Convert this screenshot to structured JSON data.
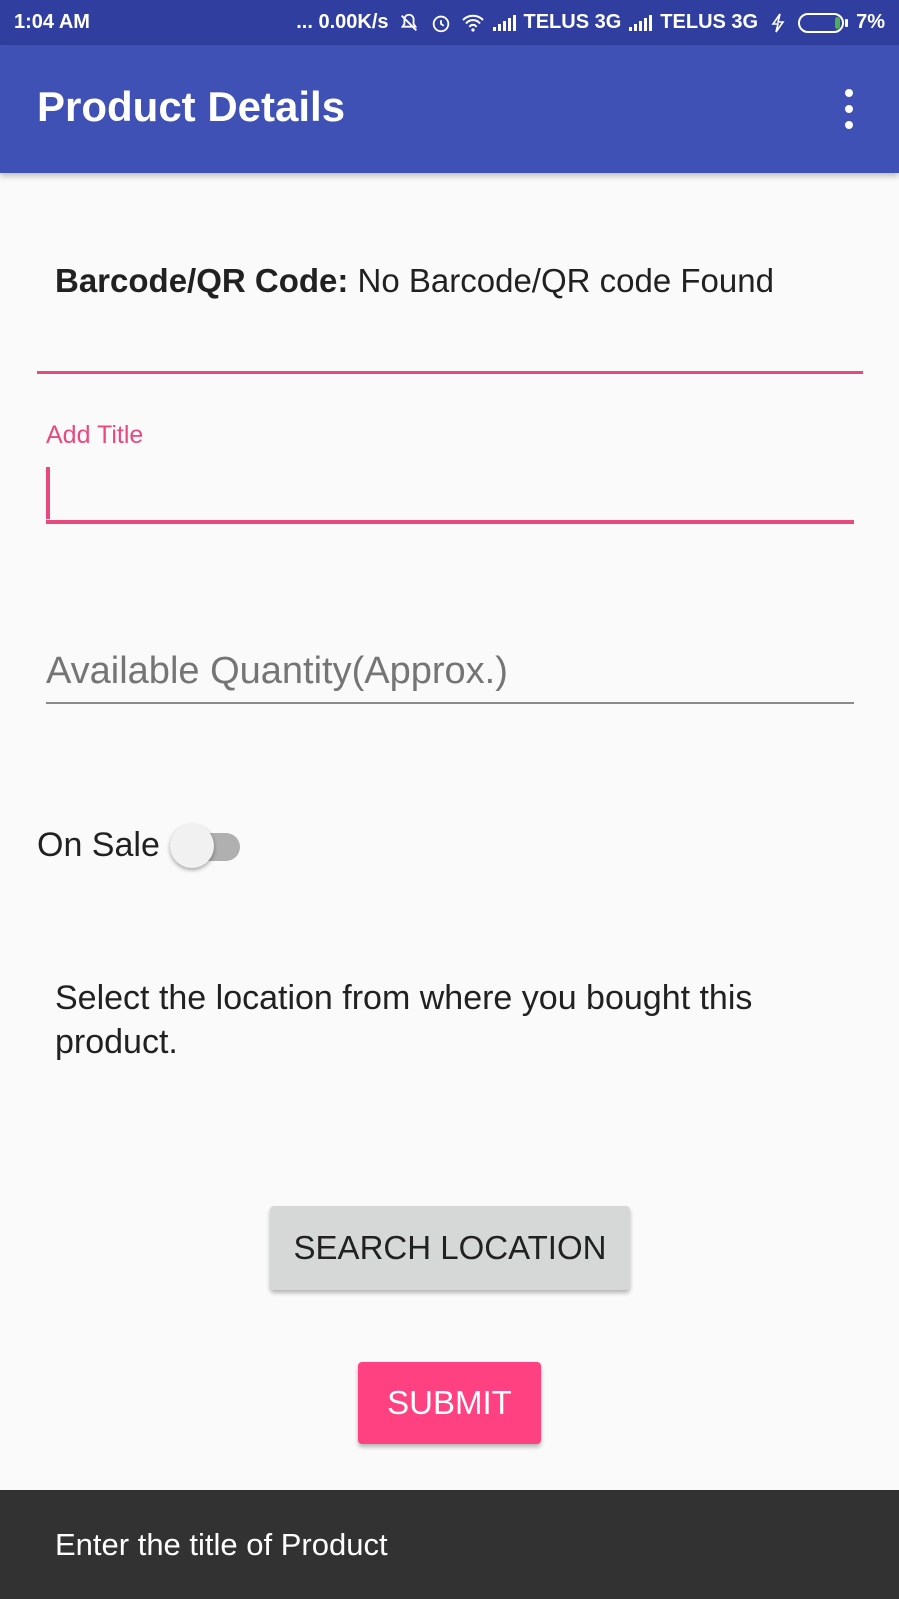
{
  "status_bar": {
    "time": "1:04 AM",
    "network_speed": "... 0.00K/s",
    "carrier_1": "TELUS 3G",
    "carrier_2": "TELUS 3G",
    "battery": "7%",
    "icons": [
      "mute-icon",
      "alarm-icon",
      "wifi-icon",
      "signal-icon",
      "charging-icon",
      "battery-icon"
    ]
  },
  "app_bar": {
    "title": "Product Details",
    "menu_icon": "more-vert-icon"
  },
  "form": {
    "barcode_label": "Barcode/QR Code:",
    "barcode_value": "No Barcode/QR code Found",
    "title_label": "Add Title",
    "title_value": "",
    "quantity_placeholder": "Available Quantity(Approx.)",
    "on_sale_label": "On Sale",
    "on_sale_checked": false,
    "location_prompt": "Select the location from where you bought this product.",
    "search_location_label": "SEARCH LOCATION",
    "submit_label": "SUBMIT"
  },
  "snackbar": {
    "message": "Enter the title of Product"
  },
  "colors": {
    "status_bar": "#303f9f",
    "app_bar": "#3f51b5",
    "accent": "#ff4081",
    "snackbar": "#323232"
  }
}
